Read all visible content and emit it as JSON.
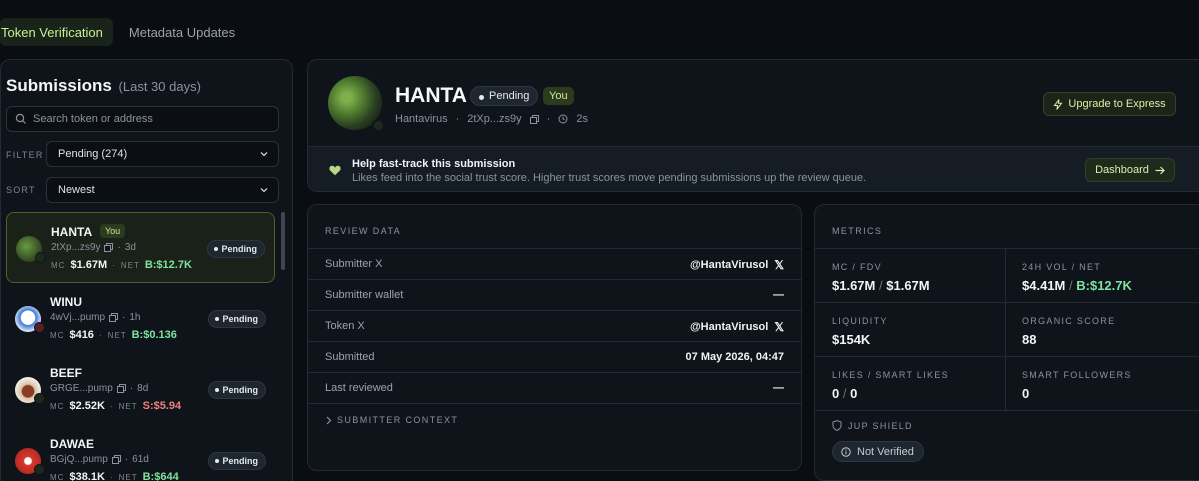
{
  "nav": {
    "tabs": [
      "Token Verification",
      "Metadata Updates"
    ]
  },
  "sidebar": {
    "title": "Submissions",
    "subtitle": "(Last 30 days)",
    "search_placeholder": "Search token or address",
    "filter_label": "FILTER",
    "filter_value": "Pending (274)",
    "sort_label": "SORT",
    "sort_value": "Newest",
    "items": [
      {
        "name": "HANTA",
        "you": "You",
        "addr": "2tXp...zs9y",
        "age": "3d",
        "mc_label": "MC",
        "mc": "$1.67M",
        "net_label": "NET",
        "net": "B:$12.7K",
        "net_color": "#7fe3a0",
        "status": "Pending"
      },
      {
        "name": "WINU",
        "addr": "4wVj...pump",
        "age": "1h",
        "mc_label": "MC",
        "mc": "$416",
        "net_label": "NET",
        "net": "B:$0.136",
        "net_color": "#7fe3a0",
        "status": "Pending"
      },
      {
        "name": "BEEF",
        "addr": "GRGE...pump",
        "age": "8d",
        "mc_label": "MC",
        "mc": "$2.52K",
        "net_label": "NET",
        "net": "S:$5.94",
        "net_color": "#f08080",
        "status": "Pending"
      },
      {
        "name": "DAWAE",
        "addr": "BGjQ...pump",
        "age": "61d",
        "mc_label": "MC",
        "mc": "$38.1K",
        "net_label": "NET",
        "net": "B:$644",
        "net_color": "#7fe3a0",
        "status": "Pending"
      }
    ]
  },
  "token": {
    "name": "HANTA",
    "status": "Pending",
    "you": "You",
    "fullname": "Hantavirus",
    "addr": "2tXp...zs9y",
    "age": "2s",
    "upgrade_label": "Upgrade to Express"
  },
  "fasttrack": {
    "heading": "Help fast-track this submission",
    "text": "Likes feed into the social trust score. Higher trust scores move pending submissions up the review queue.",
    "button": "Dashboard"
  },
  "review": {
    "title": "REVIEW DATA",
    "rows": [
      {
        "label": "Submitter X",
        "value": "@HantaVirusol"
      },
      {
        "label": "Submitter wallet",
        "value": "—"
      },
      {
        "label": "Token X",
        "value": "@HantaVirusol"
      },
      {
        "label": "Submitted",
        "value": "07 May 2026, 04:47"
      },
      {
        "label": "Last reviewed",
        "value": "—"
      }
    ],
    "context_label": "SUBMITTER CONTEXT"
  },
  "metrics": {
    "title": "METRICS",
    "mc_fdv_label": "MC / FDV",
    "mc": "$1.67M",
    "fdv": "$1.67M",
    "vol_label": "24H VOL / NET",
    "vol": "$4.41M",
    "vol_net": "B:$12.7K",
    "liq_label": "LIQUIDITY",
    "liq": "$154K",
    "organic_label": "ORGANIC SCORE",
    "organic": "88",
    "likes_label": "LIKES / SMART LIKES",
    "likes": "0",
    "smart_likes": "0",
    "followers_label": "SMART FOLLOWERS",
    "followers": "0",
    "shield_label": "JUP SHIELD",
    "shield_value": "Not Verified"
  },
  "colors": {
    "accent": "#c9ef96",
    "buy": "#7fe3a0",
    "sell": "#f08080",
    "bg": "#0a0d11",
    "panel": "#0f141a"
  }
}
